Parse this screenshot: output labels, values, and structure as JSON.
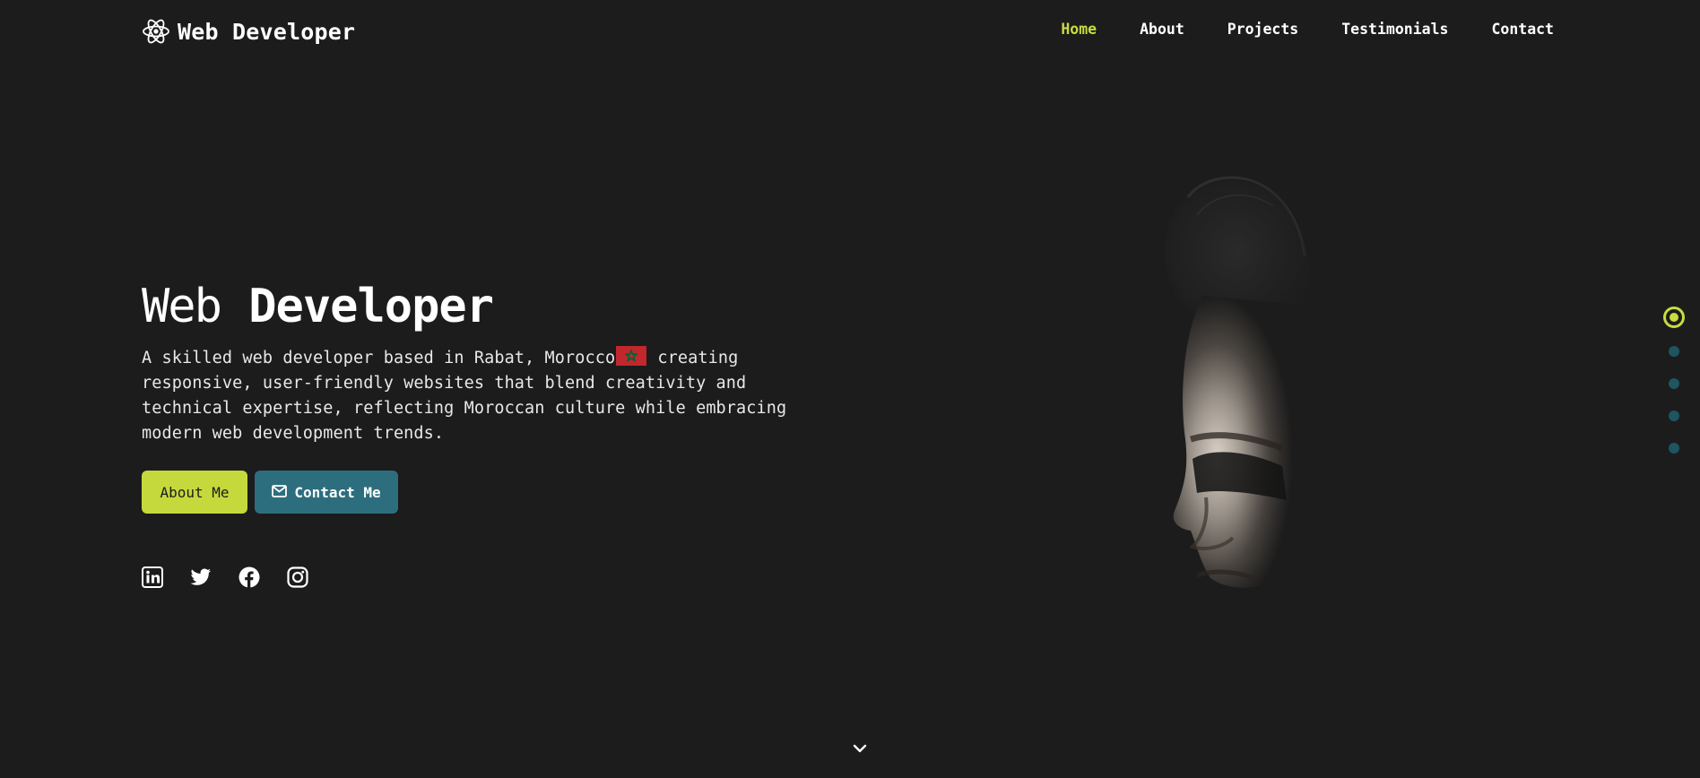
{
  "brand": {
    "name": "Web Developer",
    "icon": "atom-icon"
  },
  "nav": {
    "items": [
      {
        "label": "Home",
        "active": true
      },
      {
        "label": "About",
        "active": false
      },
      {
        "label": "Projects",
        "active": false
      },
      {
        "label": "Testimonials",
        "active": false
      },
      {
        "label": "Contact",
        "active": false
      }
    ]
  },
  "hero": {
    "title_light": "Web",
    "title_bold": "Developer",
    "description_before_flag": "A skilled web developer based in Rabat, Morocco",
    "description_after_flag": " creating responsive, user-friendly websites that blend creativity and technical expertise, reflecting Moroccan culture while embracing modern web development trends.",
    "flag_icon": "morocco-flag-icon",
    "buttons": {
      "about_label": "About Me",
      "contact_label": "Contact Me",
      "contact_icon": "envelope-icon"
    },
    "socials": [
      "linkedin-icon",
      "twitter-icon",
      "facebook-icon",
      "instagram-icon"
    ]
  },
  "section_indicator": {
    "count": 5,
    "active_index": 0
  },
  "colors": {
    "background": "#1c1c1c",
    "accent": "#c8dc3c",
    "teal": "#2d6e7e",
    "dot_inactive": "#1f5561",
    "flag_red": "#c1272d",
    "flag_star": "#006233"
  }
}
